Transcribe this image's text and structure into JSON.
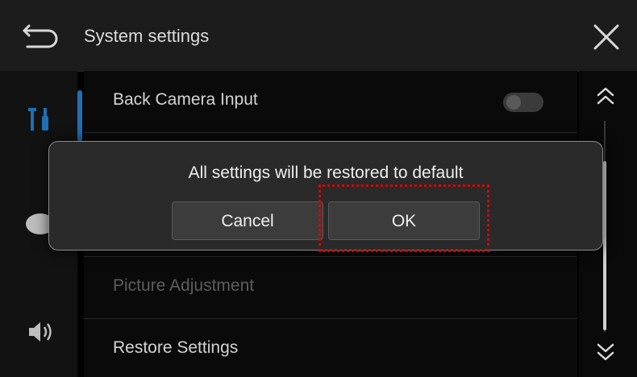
{
  "header": {
    "title": "System settings",
    "back_icon": "back-arrow-icon",
    "close_icon": "close-icon"
  },
  "rail": {
    "items": [
      {
        "icon": "tools-icon",
        "active": true
      },
      {
        "icon": "palette-icon",
        "active": false
      },
      {
        "icon": "speaker-icon",
        "active": false
      }
    ],
    "accent_color": "#1f6fb6"
  },
  "list": {
    "rows": [
      {
        "label": "Back Camera Input",
        "has_toggle": true,
        "toggle_on": false,
        "disabled": false
      },
      {
        "label": "",
        "has_toggle": false,
        "disabled": false
      },
      {
        "label": "",
        "has_toggle": false,
        "disabled": false
      },
      {
        "label": "Picture Adjustment",
        "has_toggle": false,
        "disabled": true
      },
      {
        "label": "Restore Settings",
        "has_toggle": false,
        "disabled": false
      }
    ]
  },
  "scroll": {
    "up_icon": "double-chevron-up-icon",
    "down_icon": "double-chevron-down-icon"
  },
  "dialog": {
    "message": "All settings will be restored to default",
    "cancel_label": "Cancel",
    "ok_label": "OK",
    "highlight_color": "#e00000"
  }
}
